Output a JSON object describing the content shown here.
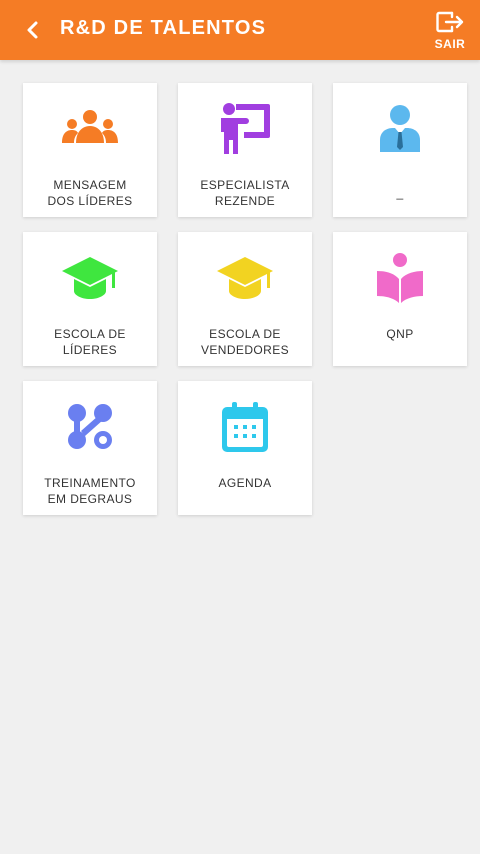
{
  "header": {
    "title": "R&D DE TALENTOS",
    "logout_label": "SAIR",
    "background_color": "#f57c25"
  },
  "tiles": [
    {
      "label": "MENSAGEM\nDOS LÍDERES",
      "icon": "group-people-icon",
      "color": "#f57c25"
    },
    {
      "label": "ESPECIALISTA\nREZENDE",
      "icon": "presenter-board-icon",
      "color": "#a13ee0"
    },
    {
      "label": "_",
      "icon": "businessman-icon",
      "color": "#5cb8ee"
    },
    {
      "label": "ESCOLA DE\nLÍDERES",
      "icon": "graduation-cap-icon",
      "color": "#3fe63f"
    },
    {
      "label": "ESCOLA DE\nVENDEDORES",
      "icon": "graduation-cap-icon",
      "color": "#f2d321"
    },
    {
      "label": "QNP",
      "icon": "reader-book-icon",
      "color": "#f06ac9"
    },
    {
      "label": "TREINAMENTO\nEM DEGRAUS",
      "icon": "nodes-graph-icon",
      "color": "#6a7ff0"
    },
    {
      "label": "AGENDA",
      "icon": "calendar-icon",
      "color": "#2ec8ec"
    }
  ]
}
